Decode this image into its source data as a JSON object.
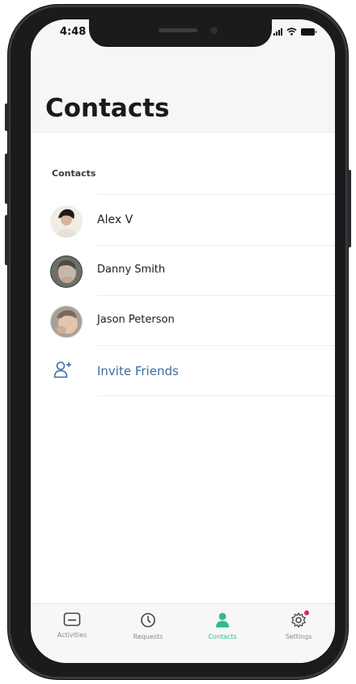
{
  "status_bar": {
    "time": "4:48"
  },
  "header": {
    "title": "Contacts"
  },
  "section": {
    "label": "Contacts"
  },
  "contacts": [
    {
      "name": "Alex V",
      "avatar_icon": "person-photo-icon"
    },
    {
      "name": "Danny Smith",
      "avatar_icon": "person-photo-icon"
    },
    {
      "name": "Jason Peterson",
      "avatar_icon": "person-photo-icon"
    }
  ],
  "invite": {
    "label": "Invite Friends",
    "icon": "add-user-icon"
  },
  "tabs": [
    {
      "label": "Activities",
      "icon": "activities-icon",
      "active": false
    },
    {
      "label": "Requests",
      "icon": "clock-icon",
      "active": false
    },
    {
      "label": "Contacts",
      "icon": "person-icon",
      "active": true
    },
    {
      "label": "Settings",
      "icon": "gear-icon",
      "active": false,
      "badge": true
    }
  ],
  "colors": {
    "accent": "#2fbf84",
    "link": "#3d6aa5",
    "badge": "#e0284f"
  }
}
